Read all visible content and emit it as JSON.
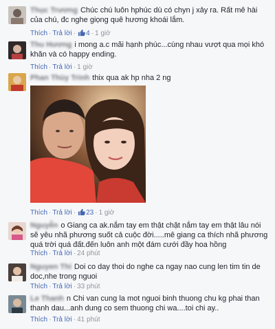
{
  "comments": [
    {
      "name": "Thục Trương",
      "text": "Chúc chú luôn hphúc dù có chyn j xảy ra. Rất mê hài của chú, đc nghe giọng quê hương khoái lắm.",
      "like_label": "Thích",
      "reply_label": "Trả lời",
      "likes": "4",
      "time": "1 giờ"
    },
    {
      "name": "Thu Hương",
      "text": "i mong a.c mãi hạnh phúc...cùng nhau vượt qua mọi khó khăn và có happy ending.",
      "like_label": "Thích",
      "reply_label": "Trả lời",
      "time": "1 giờ"
    },
    {
      "name": "Phan Thùy Trinh",
      "text": "thix qua ak hp nha 2 ng",
      "like_label": "Thích",
      "reply_label": "Trả lời",
      "likes": "23",
      "time": "1 giờ"
    },
    {
      "name": "Nguyễn",
      "text": "o Giang ca ak.nắm tay em thật chặt nắm tay em thật lâu nói sẽ yêu nhã phương suốt cả cuộc đời.....mê giang ca thích nhã phương quá trời quá đất.đến luôn anh một đám cưới đầy hoa hồng",
      "like_label": "Thích",
      "reply_label": "Trả lời",
      "time": "24 phút"
    },
    {
      "name": "Nguyen Thi",
      "text": "Doi co day thoi do nghe ca ngay nao cung len tim tin de doc,nhe trong nguoi",
      "like_label": "Thích",
      "reply_label": "Trả lời",
      "time": "33 phút"
    },
    {
      "name": "Le Thanh",
      "text": "n Chi van cung la mot nguoi binh thuong chu kg phai than thanh dau...anh dung co sem thuong chi wa....toi chi ay..",
      "like_label": "Thích",
      "reply_label": "Trả lời",
      "time": "41 phút"
    }
  ],
  "colors": {
    "link": "#4267b2",
    "meta": "#90949c",
    "background": "#f6f7f9"
  },
  "icons": [
    "thumbs-up-icon",
    "avatar"
  ]
}
